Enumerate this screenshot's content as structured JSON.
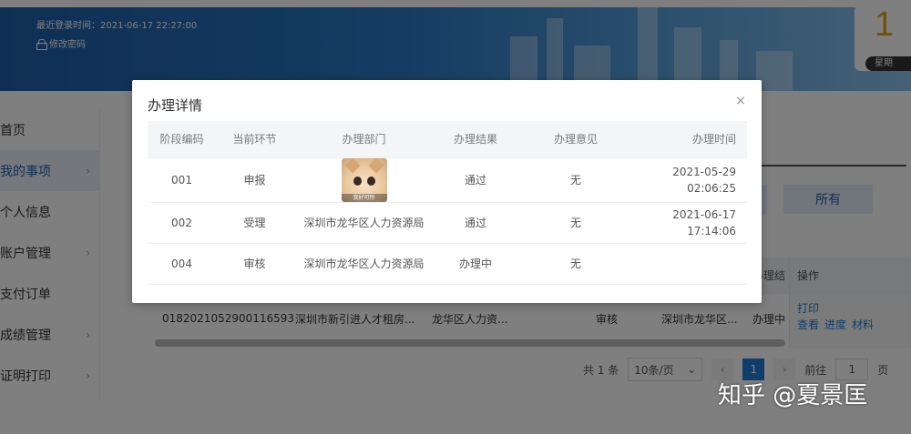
{
  "banner": {
    "last_login": "最近登录时间：2021-06-17 22:27:00",
    "change_password": "修改密码",
    "clock_digits": "1",
    "weekday": "星期"
  },
  "sidebar": {
    "items": [
      {
        "label": "首页",
        "chevron": ""
      },
      {
        "label": "我的事项",
        "chevron": "›"
      },
      {
        "label": "个人信息",
        "chevron": ""
      },
      {
        "label": "账户管理",
        "chevron": "›"
      },
      {
        "label": "支付订单",
        "chevron": ""
      },
      {
        "label": "成绩管理",
        "chevron": "›"
      },
      {
        "label": "证明打印",
        "chevron": "›"
      }
    ]
  },
  "filters": {
    "all": "所有"
  },
  "background_table": {
    "partial_header": "办理结",
    "ops_header": "操作",
    "row": {
      "id": "0182021052900116593",
      "item": "深圳市新引进人才租房...",
      "dept": "龙华区人力资...",
      "stage": "审核",
      "handler": "深圳市龙华区...",
      "result": "办理中"
    },
    "actions": {
      "print": "打印",
      "view": "查看",
      "progress": "进度",
      "material": "材料"
    }
  },
  "pagination": {
    "total": "共 1 条",
    "page_size": "10条/页",
    "prev": "‹",
    "current": "1",
    "next": "›",
    "goto_label": "前往",
    "goto_value": "1",
    "page_suffix": "页"
  },
  "modal": {
    "title": "办理详情",
    "close": "×",
    "columns": [
      "阶段编码",
      "当前环节",
      "办理部门",
      "办理结果",
      "办理意见",
      "办理时间"
    ],
    "rows": [
      {
        "code": "001",
        "step": "申报",
        "dept": "",
        "result": "通过",
        "opinion": "无",
        "time_date": "2021-05-29",
        "time_clock": "02:06:25",
        "has_image": true
      },
      {
        "code": "002",
        "step": "受理",
        "dept": "深圳市龙华区人力资源局",
        "result": "通过",
        "opinion": "无",
        "time_date": "2021-06-17",
        "time_clock": "17:14:06",
        "has_image": false
      },
      {
        "code": "004",
        "step": "审核",
        "dept": "深圳市龙华区人力资源局",
        "result": "办理中",
        "opinion": "无",
        "time_date": "",
        "time_clock": "",
        "has_image": false
      }
    ],
    "image_caption": "我好可怜"
  },
  "watermark": "知乎 @夏景匡"
}
